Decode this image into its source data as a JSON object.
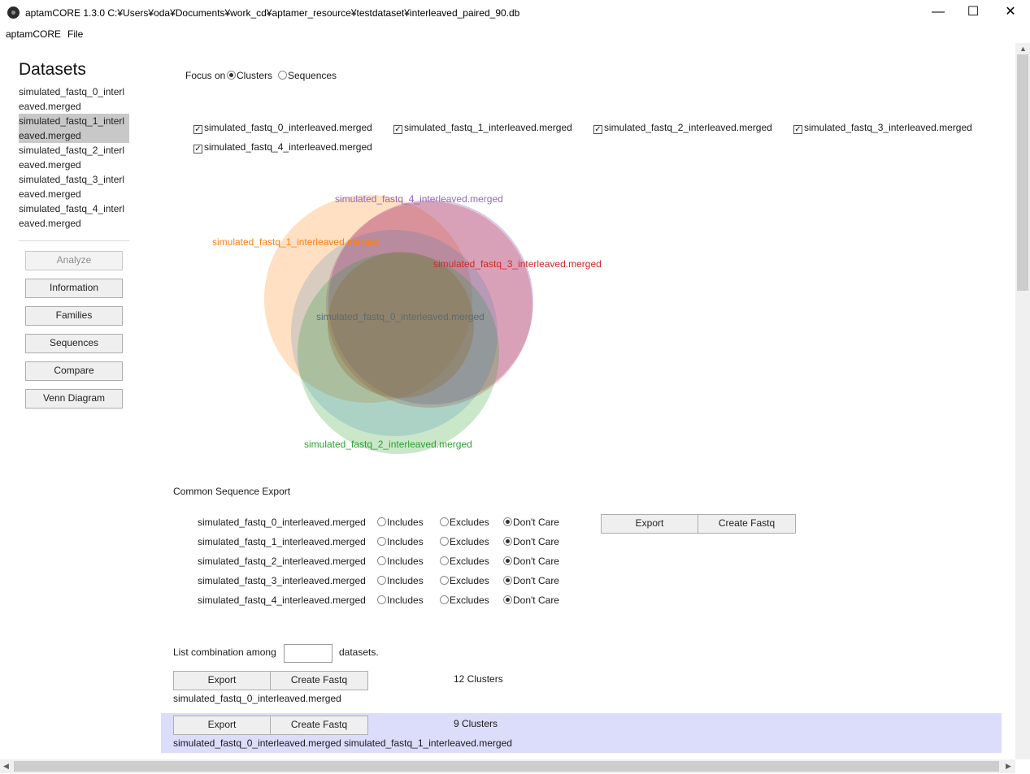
{
  "window": {
    "title": "aptamCORE 1.3.0 C:¥Users¥oda¥Documents¥work_cd¥aptamer_resource¥testdataset¥interleaved_paired_90.db",
    "minimize": "—",
    "maximize": "☐",
    "close": "✕"
  },
  "menu": {
    "app": "aptamCORE",
    "file": "File"
  },
  "sidebar": {
    "heading": "Datasets",
    "datasets": [
      "simulated_fastq_0_interleaved.merged",
      "simulated_fastq_1_interleaved.merged",
      "simulated_fastq_2_interleaved.merged",
      "simulated_fastq_3_interleaved.merged",
      "simulated_fastq_4_interleaved.merged"
    ],
    "selected_index": 1,
    "buttons": {
      "analyze": "Analyze",
      "information": "Information",
      "families": "Families",
      "sequences": "Sequences",
      "compare": "Compare",
      "venn": "Venn Diagram"
    }
  },
  "focus": {
    "label": "Focus on",
    "clusters": "Clusters",
    "sequences": "Sequences",
    "selected": "Clusters"
  },
  "dataset_checks": [
    {
      "label": "simulated_fastq_0_interleaved.merged",
      "checked": true
    },
    {
      "label": "simulated_fastq_1_interleaved.merged",
      "checked": true
    },
    {
      "label": "simulated_fastq_2_interleaved.merged",
      "checked": true
    },
    {
      "label": "simulated_fastq_3_interleaved.merged",
      "checked": true
    },
    {
      "label": "simulated_fastq_4_interleaved.merged",
      "checked": true
    }
  ],
  "venn": {
    "sets": [
      {
        "label": "simulated_fastq_4_interleaved.merged",
        "color": "#9467bd"
      },
      {
        "label": "simulated_fastq_1_interleaved.merged",
        "color": "#ff7f0e"
      },
      {
        "label": "simulated_fastq_3_interleaved.merged",
        "color": "#d62728"
      },
      {
        "label": "simulated_fastq_0_interleaved.merged",
        "color": "#1f77b4"
      },
      {
        "label": "simulated_fastq_2_interleaved.merged",
        "color": "#2ca02c"
      }
    ]
  },
  "common_export": {
    "heading": "Common Sequence Export",
    "rows": [
      {
        "label": "simulated_fastq_0_interleaved.merged",
        "selected": "Don't Care"
      },
      {
        "label": "simulated_fastq_1_interleaved.merged",
        "selected": "Don't Care"
      },
      {
        "label": "simulated_fastq_2_interleaved.merged",
        "selected": "Don't Care"
      },
      {
        "label": "simulated_fastq_3_interleaved.merged",
        "selected": "Don't Care"
      },
      {
        "label": "simulated_fastq_4_interleaved.merged",
        "selected": "Don't Care"
      }
    ],
    "options": {
      "includes": "Includes",
      "excludes": "Excludes",
      "dont_care": "Don't Care"
    },
    "export": "Export",
    "create_fastq": "Create Fastq"
  },
  "combination": {
    "label_before": "List combination among",
    "label_after": "datasets.",
    "value": "",
    "results": [
      {
        "export": "Export",
        "create_fastq": "Create Fastq",
        "count": "12 Clusters",
        "datasets": "simulated_fastq_0_interleaved.merged"
      },
      {
        "export": "Export",
        "create_fastq": "Create Fastq",
        "count": "9 Clusters",
        "datasets": "simulated_fastq_0_interleaved.merged simulated_fastq_1_interleaved.merged"
      }
    ]
  }
}
